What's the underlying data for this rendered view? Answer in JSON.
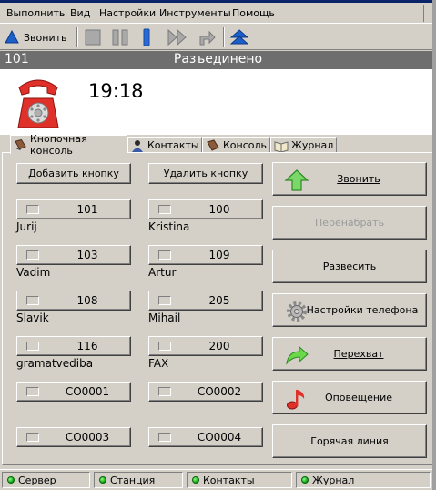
{
  "menu": [
    "Выполнить",
    "Вид",
    "Настройки",
    "Инструменты",
    "Помощь"
  ],
  "toolbar": {
    "call_label": "Звонить"
  },
  "line": {
    "number": "101",
    "state": "Разъединено"
  },
  "call": {
    "timer": "19:18"
  },
  "tabs": [
    "Кнопочная консоль",
    "Контакты",
    "Консоль",
    "Журнал"
  ],
  "console": {
    "add_button": "Добавить кнопку",
    "delete_button": "Удалить кнопку",
    "keys": [
      {
        "num": "101",
        "name": "Jurij"
      },
      {
        "num": "100",
        "name": "Kristina"
      },
      {
        "num": "103",
        "name": "Vadim"
      },
      {
        "num": "109",
        "name": "Artur"
      },
      {
        "num": "108",
        "name": "Slavik"
      },
      {
        "num": "205",
        "name": "Mihail"
      },
      {
        "num": "116",
        "name": "gramatvediba"
      },
      {
        "num": "200",
        "name": "FAX"
      },
      {
        "num": "CO0001",
        "name": ""
      },
      {
        "num": "CO0002",
        "name": ""
      },
      {
        "num": "CO0003",
        "name": ""
      },
      {
        "num": "CO0004",
        "name": ""
      }
    ]
  },
  "actions": {
    "call": "Звонить",
    "redial": "Перенабрать",
    "hangup": "Развесить",
    "phone_settings": "Настройки телефона",
    "pickup": "Перехват",
    "paging": "Оповещение",
    "hotline": "Горячая линия"
  },
  "statusbar": [
    "Сервер",
    "Станция",
    "Контакты",
    "Журнал"
  ],
  "colors": {
    "status_led": "#16b516",
    "line_bar": "#6e6e6e",
    "accent": "#0a246a",
    "phone_red": "#e0302a"
  }
}
